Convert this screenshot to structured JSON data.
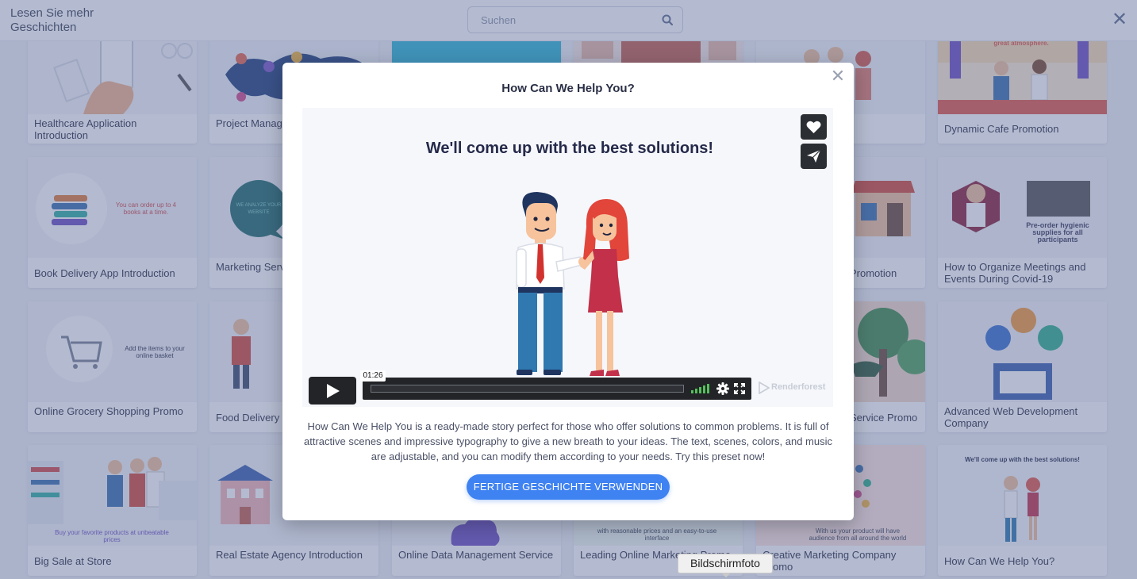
{
  "header": {
    "more_stories": "Lesen Sie mehr Geschichten",
    "search_placeholder": "Suchen"
  },
  "colors": {
    "accent": "#3f82f2",
    "overlay": "#586896",
    "volume": "#53c05c"
  },
  "cards": [
    {
      "title": "Healthcare Application Introduction",
      "thumb_text": ""
    },
    {
      "title": "Project Management Promo",
      "thumb_text": ""
    },
    {
      "title": "",
      "thumb_text": ""
    },
    {
      "title": "",
      "thumb_text": ""
    },
    {
      "title": "",
      "thumb_text": ""
    },
    {
      "title": "Dynamic Cafe Promotion",
      "thumb_text": "great atmosphere."
    },
    {
      "title": "Book Delivery App Introduction",
      "thumb_text": "You can order up to 4 books at a time."
    },
    {
      "title": "Marketing Services Introduction",
      "thumb_text": "WE ANALYZE YOUR WEBSITE"
    },
    {
      "title": "",
      "thumb_text": ""
    },
    {
      "title": "",
      "thumb_text": ""
    },
    {
      "title": "Promotion",
      "thumb_text": ""
    },
    {
      "title": "How to Organize Meetings and Events During Covid-19",
      "thumb_text": "Pre-order hygienic supplies for all participants"
    },
    {
      "title": "Online Grocery Shopping Promo",
      "thumb_text": "Add the items to your online basket"
    },
    {
      "title": "Food Delivery",
      "thumb_text": ""
    },
    {
      "title": "",
      "thumb_text": ""
    },
    {
      "title": "",
      "thumb_text": ""
    },
    {
      "title": "Service Promo",
      "thumb_text": ""
    },
    {
      "title": "Advanced Web Development Company",
      "thumb_text": ""
    },
    {
      "title": "Big Sale at Store",
      "thumb_text": "Buy your favorite products at unbeatable prices"
    },
    {
      "title": "Real Estate Agency Introduction",
      "thumb_text": ""
    },
    {
      "title": "Online Data Management Service",
      "thumb_text": ""
    },
    {
      "title": "Leading Online Marketing Promo",
      "thumb_text": "with reasonable prices and an easy-to-use interface"
    },
    {
      "title": "Creative Marketing Company Promo",
      "thumb_text": "With us your product will have audience from all around the world"
    },
    {
      "title": "How Can We Help You?",
      "thumb_text": "We'll come up with the best solutions!"
    }
  ],
  "modal": {
    "title": "How Can We Help You?",
    "video": {
      "headline": "We'll come up with the best solutions!",
      "time": "01:26",
      "like_icon": "heart-icon",
      "share_icon": "paper-plane-icon",
      "watermark": "Renderforest"
    },
    "description": "How Can We Help You is a ready-made story perfect for those who offer solutions to common problems. It is full of attractive scenes and impressive typography to give a new breath to your ideas. The text, scenes, colors, and music are adjustable, and you can modify them according to your needs. Try this preset now!",
    "cta": "FERTIGE GESCHICHTE VERWENDEN"
  },
  "tooltip": "Bildschirmfoto"
}
